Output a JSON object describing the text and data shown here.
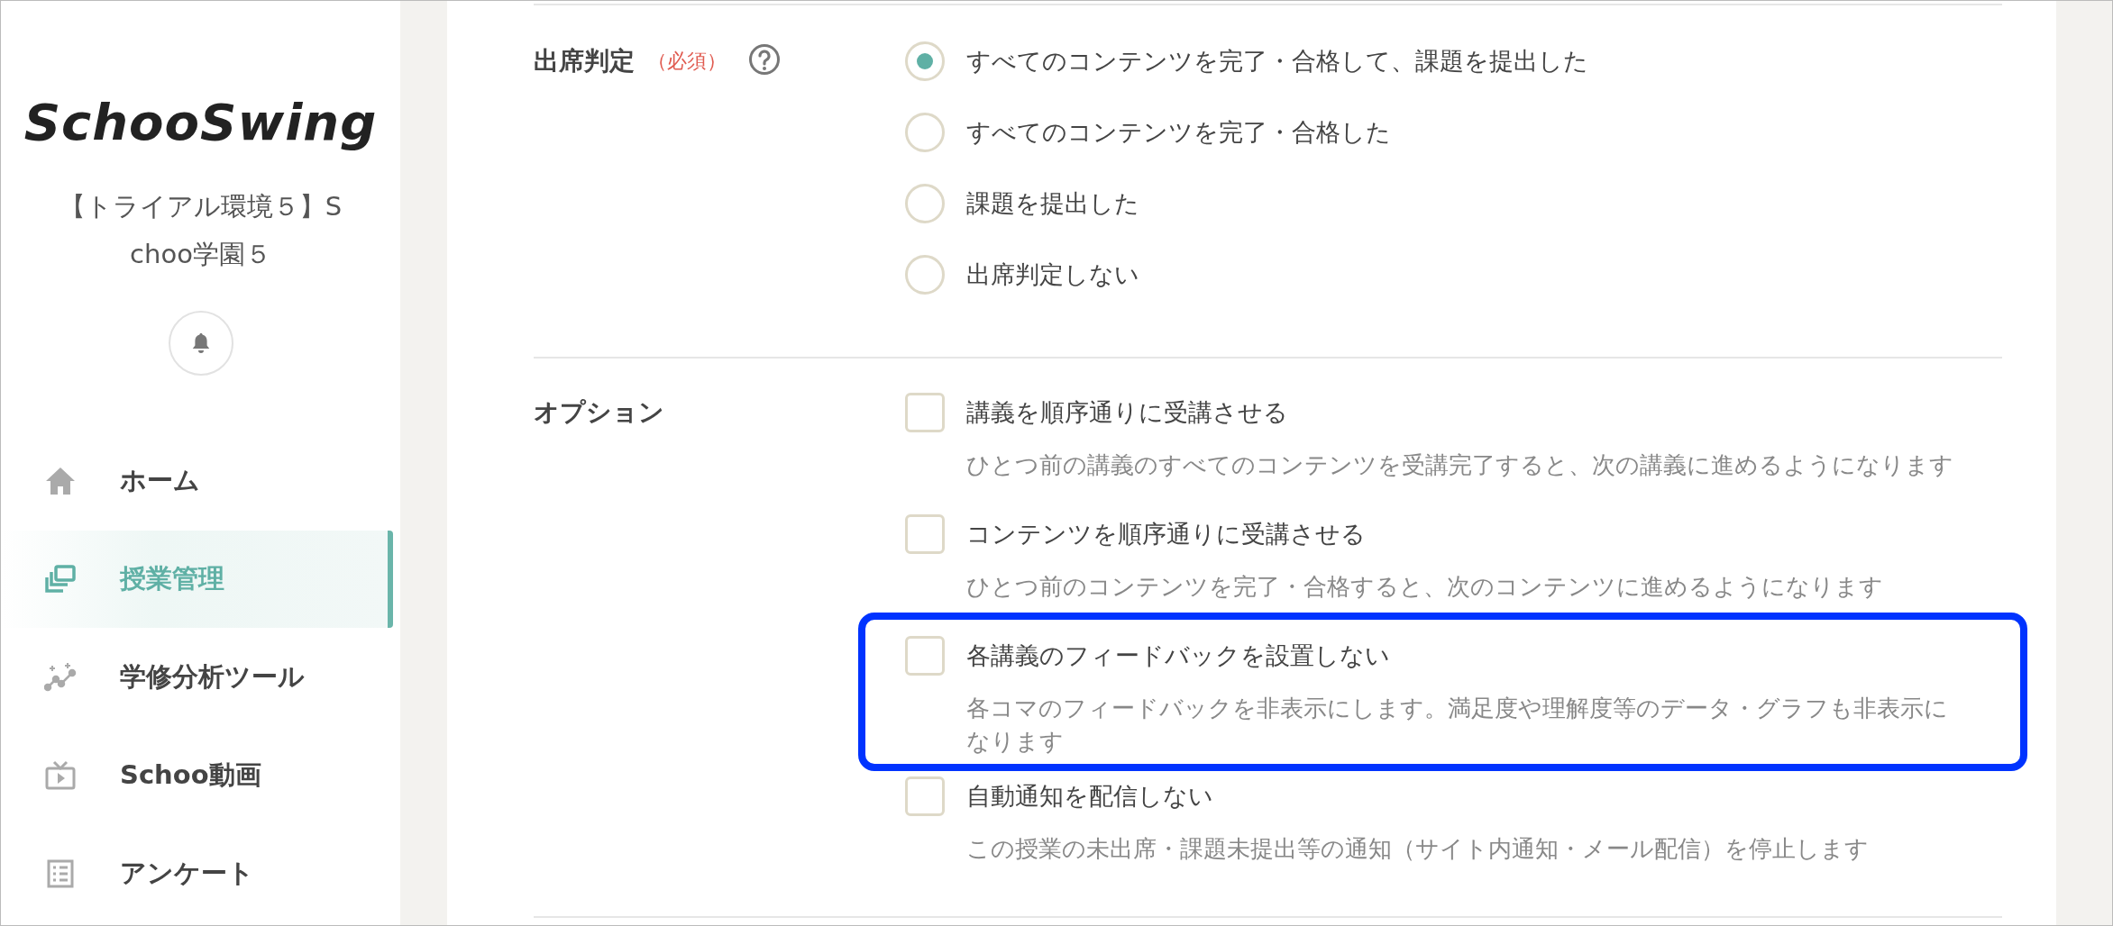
{
  "sidebar": {
    "logo": "SchooSwing",
    "tenant": "【トライアル環境５】Schoo学園５",
    "nav": [
      {
        "label": "ホーム",
        "selected": false
      },
      {
        "label": "授業管理",
        "selected": true
      },
      {
        "label": "学修分析ツール",
        "selected": false
      },
      {
        "label": "Schoo動画",
        "selected": false
      },
      {
        "label": "アンケート",
        "selected": false
      }
    ]
  },
  "sections": [
    {
      "kind": "radio",
      "label": "出席判定",
      "required": "（必須）",
      "options": [
        {
          "label": "すべてのコンテンツを完了・合格して、課題を提出した",
          "selected": true
        },
        {
          "label": "すべてのコンテンツを完了・合格した",
          "selected": false
        },
        {
          "label": "課題を提出した",
          "selected": false
        },
        {
          "label": "出席判定しない",
          "selected": false
        }
      ]
    },
    {
      "kind": "checkbox",
      "label": "オプション",
      "options": [
        {
          "label": "講義を順序通りに受講させる",
          "description": "ひとつ前の講義のすべてのコンテンツを受講完了すると、次の講義に進めるようになります",
          "checked": false,
          "highlighted": false
        },
        {
          "label": "コンテンツを順序通りに受講させる",
          "description": "ひとつ前のコンテンツを完了・合格すると、次のコンテンツに進めるようになります",
          "checked": false,
          "highlighted": false
        },
        {
          "label": "各講義のフィードバックを設置しない",
          "description": "各コマのフィードバックを非表示にします。満足度や理解度等のデータ・グラフも非表示になります",
          "checked": false,
          "highlighted": true
        },
        {
          "label": "自動通知を配信しない",
          "description": "この授業の未出席・課題未提出等の通知（サイト内通知・メール配信）を停止します",
          "checked": false,
          "highlighted": false
        }
      ]
    }
  ]
}
